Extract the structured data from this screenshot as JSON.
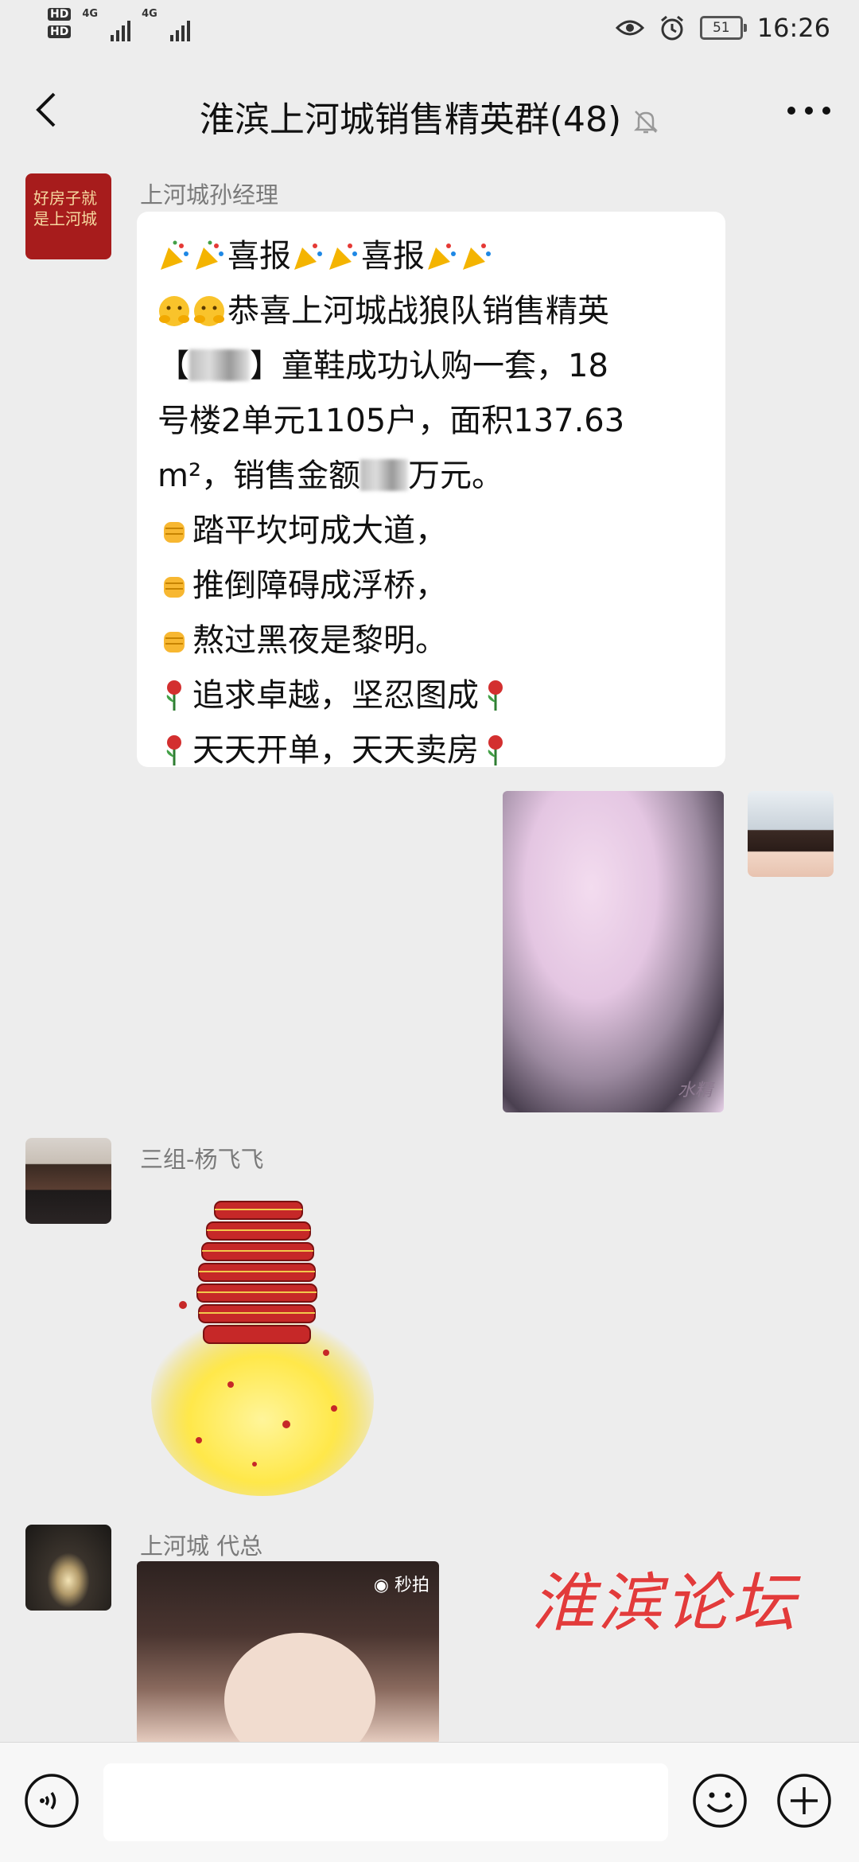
{
  "status": {
    "network1": "4G",
    "network2": "4G",
    "battery": "51",
    "time": "16:26"
  },
  "header": {
    "title": "淮滨上河城销售精英群(48)"
  },
  "messages": [
    {
      "sender": "上河城孙经理",
      "avatar_text": "好房子就是上河城",
      "lines": [
        "喜报",
        "喜报",
        "恭喜上河城战狼队销售精英",
        "【",
        "】童鞋成功认购一套，18",
        "号楼2单元1105户，面积137.63",
        "m²，销售金额",
        "万元。",
        "踏平坎坷成大道，",
        "推倒障碍成浮桥，",
        "熬过黑夜是黎明。",
        "追求卓越，坚忍图成",
        "天天开单，天天卖房"
      ]
    },
    {
      "sender": "",
      "image_caption": "水精"
    },
    {
      "sender": "三组-杨飞飞"
    },
    {
      "sender": "上河城 代总",
      "video_badge": "秒拍"
    }
  ],
  "watermark": "淮滨论坛",
  "colors": {
    "background": "#ededed",
    "bubble": "#ffffff",
    "watermark": "#e23b3b"
  },
  "icons": [
    "back-arrow-icon",
    "mute-bell-icon",
    "more-icon",
    "voice-icon",
    "emoji-icon",
    "add-icon",
    "party-popper-icon",
    "fist-icon",
    "rose-icon",
    "hug-face-icon",
    "eye-icon",
    "alarm-icon"
  ]
}
